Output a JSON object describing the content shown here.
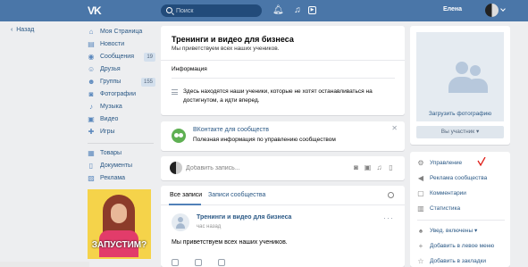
{
  "header": {
    "logo": "VK",
    "search_placeholder": "Поиск",
    "user_name": "Елена"
  },
  "back_link": "Назад",
  "menu": {
    "items": [
      {
        "label": "Моя Страница",
        "icon": "home-icon"
      },
      {
        "label": "Новости",
        "icon": "news-icon"
      },
      {
        "label": "Сообщения",
        "icon": "messages-icon",
        "count": "19"
      },
      {
        "label": "Друзья",
        "icon": "friends-icon"
      },
      {
        "label": "Группы",
        "icon": "groups-icon",
        "count": "155"
      },
      {
        "label": "Фотографии",
        "icon": "photos-icon"
      },
      {
        "label": "Музыка",
        "icon": "music-icon"
      },
      {
        "label": "Видео",
        "icon": "video-icon"
      },
      {
        "label": "Игры",
        "icon": "games-icon"
      }
    ],
    "items2": [
      {
        "label": "Товары",
        "icon": "goods-icon"
      },
      {
        "label": "Документы",
        "icon": "docs-icon"
      },
      {
        "label": "Реклама",
        "icon": "ads-icon"
      }
    ]
  },
  "ad": {
    "text": "ЗАПУСТИМ?"
  },
  "group": {
    "title": "Тренинги и видео для бизнеса",
    "status": "Мы приветствуем всех наших учеников.",
    "info_label": "Информация",
    "description": "Здесь находятся наши ученики, которые не хотят останавливаться на достигнутом, а идти вперед."
  },
  "promo": {
    "title": "ВКонтакте для сообществ",
    "text": "Полезная информация по управлению сообществом"
  },
  "composer": {
    "placeholder": "Добавить запись..."
  },
  "wall": {
    "tab_all": "Все записи",
    "tab_community": "Записи сообщества",
    "post": {
      "author": "Тренинги и видео для бизнеса",
      "time": "час назад",
      "text": "Мы приветствуем всех наших учеников."
    }
  },
  "right": {
    "upload_photo": "Загрузить фотографию",
    "member_button": "Вы участник",
    "actions": [
      {
        "label": "Управление",
        "icon": "gear-icon"
      },
      {
        "label": "Реклама сообщества",
        "icon": "megaphone-icon"
      },
      {
        "label": "Комментарии",
        "icon": "comments-icon"
      },
      {
        "label": "Статистика",
        "icon": "stats-icon"
      }
    ],
    "actions2": [
      {
        "label": "Увед. включены",
        "icon": "bell-icon"
      },
      {
        "label": "Добавить в левое меню",
        "icon": "plus-icon"
      },
      {
        "label": "Добавить в закладки",
        "icon": "star-icon"
      }
    ]
  },
  "colors": {
    "brand": "#4a76a8",
    "link": "#2a5885",
    "annotation": "#e0201a"
  }
}
